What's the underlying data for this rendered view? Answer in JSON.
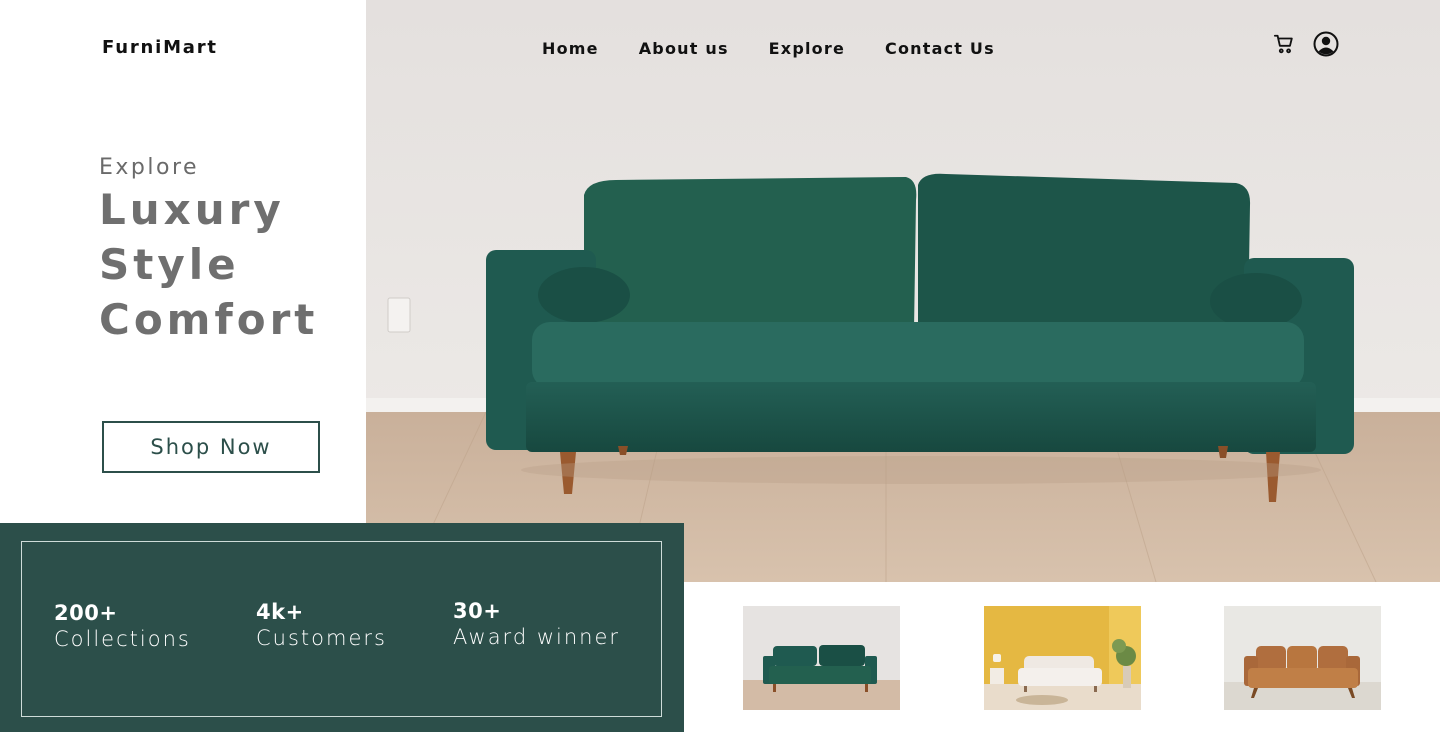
{
  "brand": {
    "name": "FurniMart"
  },
  "nav": {
    "items": [
      {
        "label": "Home"
      },
      {
        "label": "About us"
      },
      {
        "label": "Explore"
      },
      {
        "label": "Contact Us"
      }
    ]
  },
  "header_icons": {
    "cart": "cart-icon",
    "user": "user-icon"
  },
  "hero": {
    "eyebrow": "Explore",
    "headline": [
      "Luxury",
      "Style",
      "Comfort"
    ],
    "cta_label": "Shop Now",
    "image": "green-velvet-sofa-photo"
  },
  "stats": [
    {
      "value": "200+",
      "label": "Collections"
    },
    {
      "value": "4k+",
      "label": "Customers"
    },
    {
      "value": "30+",
      "label": "Award winner"
    }
  ],
  "thumbnails": [
    {
      "image": "green-sofa-thumbnail"
    },
    {
      "image": "white-sofa-yellow-wall-thumbnail"
    },
    {
      "image": "tan-leather-sofa-thumbnail"
    }
  ],
  "colors": {
    "accent": "#2c4f4a",
    "sofa": "#1f5a50",
    "text": "#111111",
    "muted": "#6f6f6f"
  }
}
